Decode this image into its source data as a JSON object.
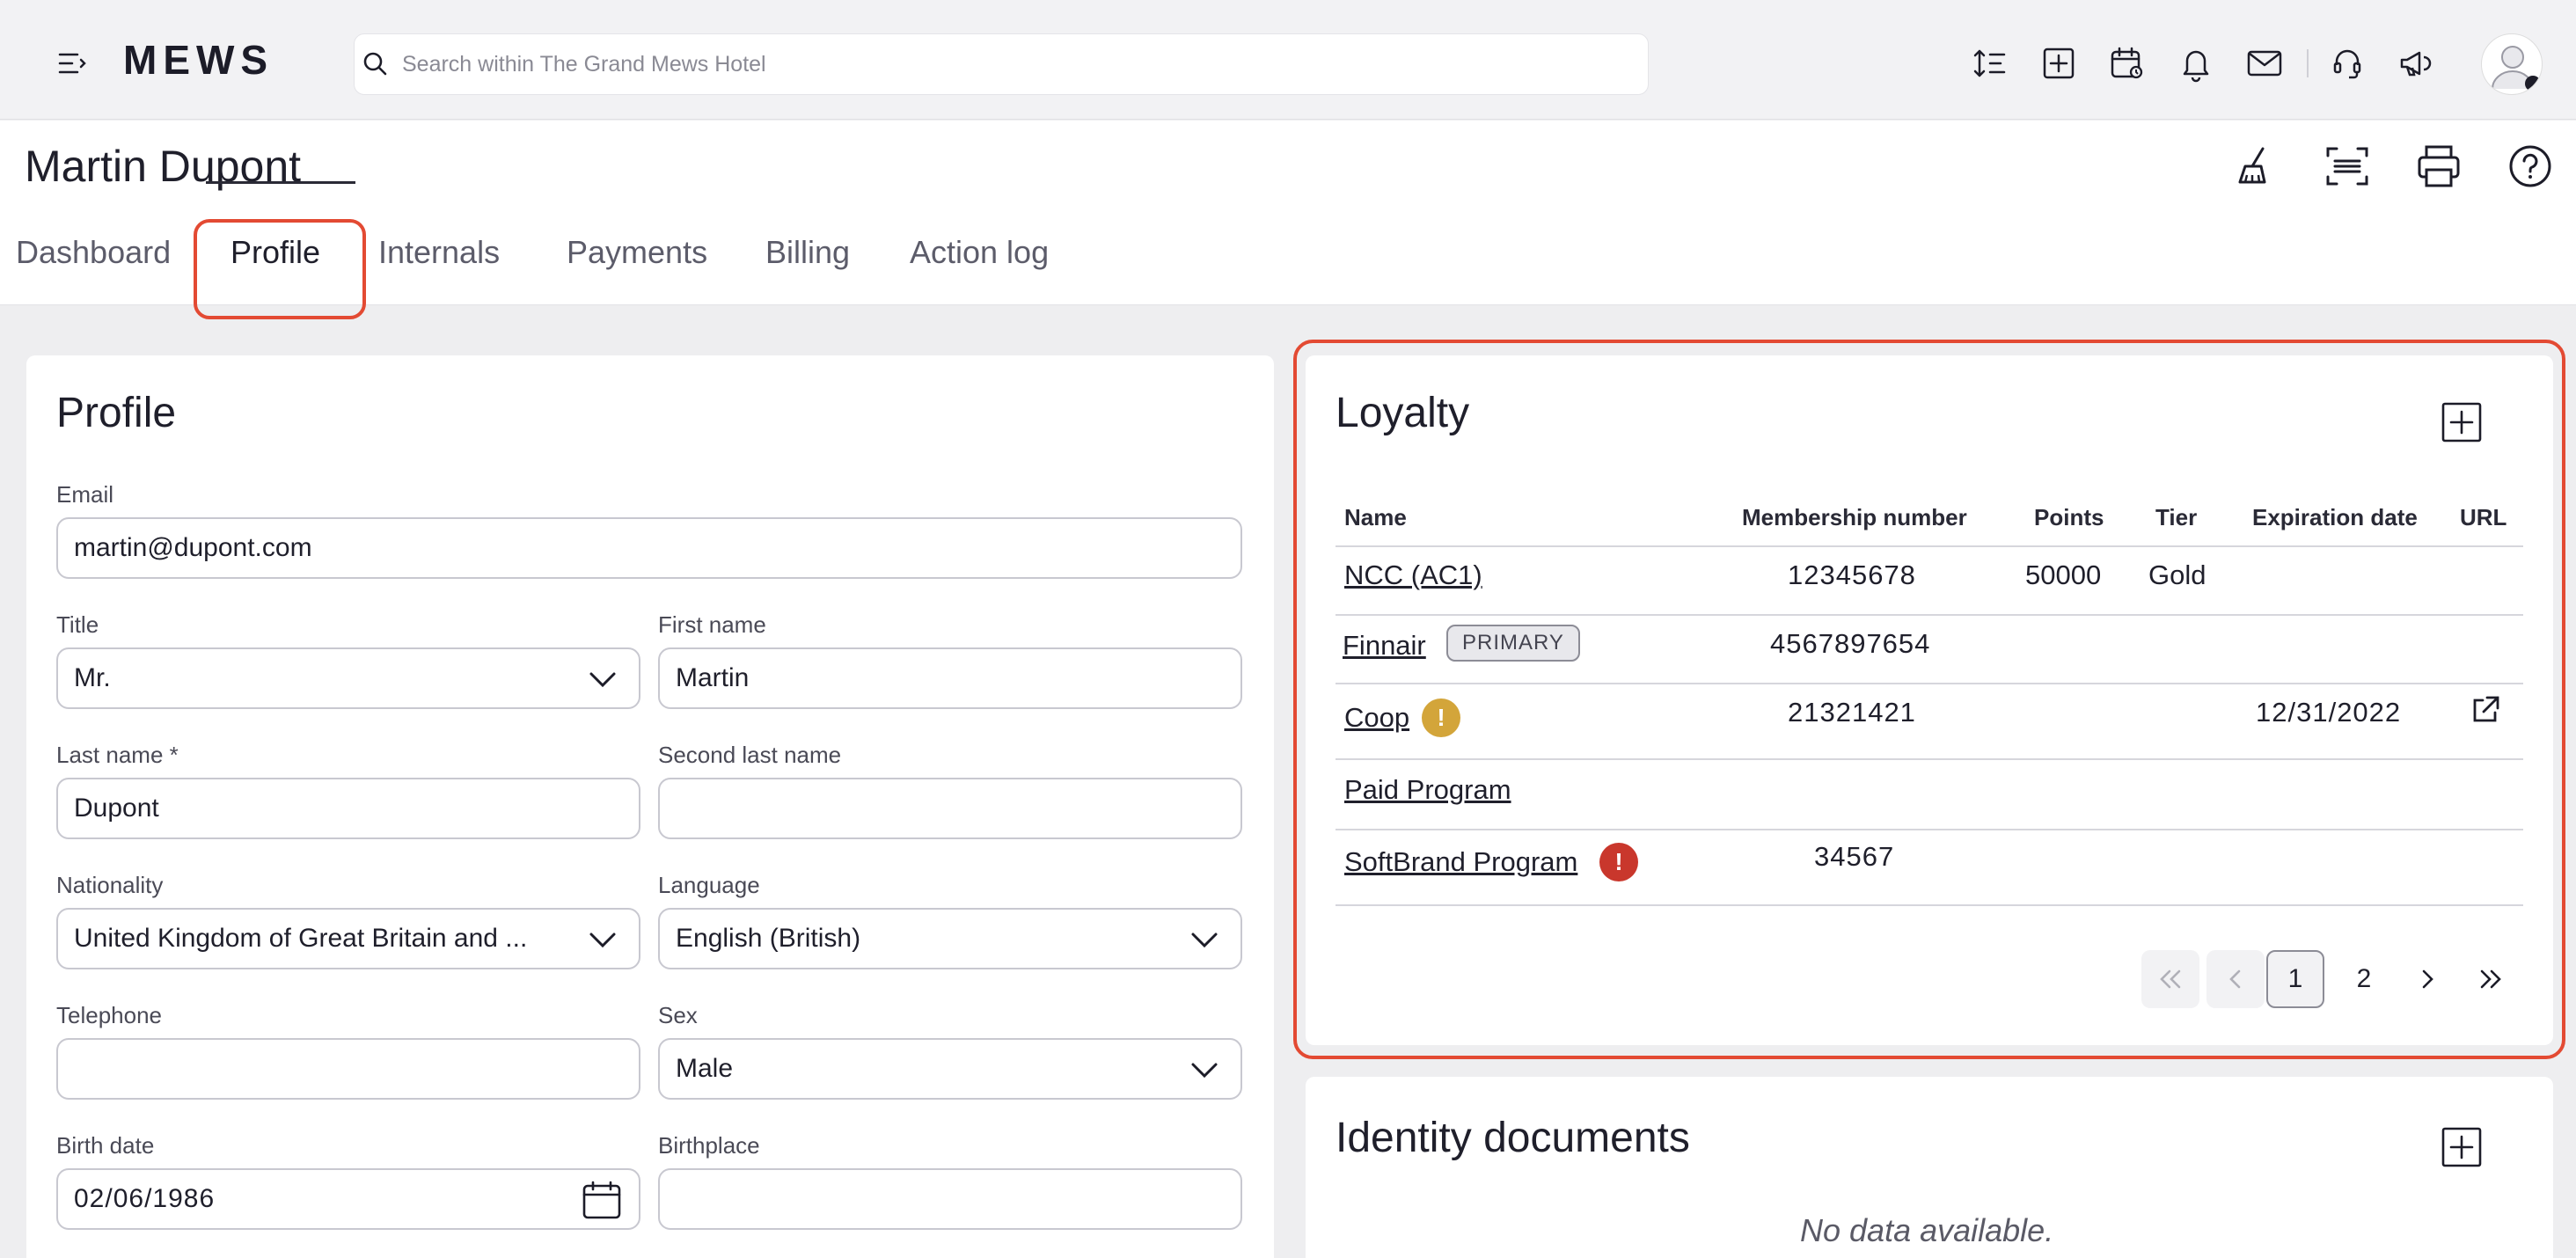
{
  "app": {
    "logo": "MEWS",
    "search_placeholder": "Search within The Grand Mews Hotel"
  },
  "topbar_icons": [
    "sort-icon",
    "add-icon",
    "calendar-icon",
    "bell-icon",
    "mail-icon",
    "support-icon",
    "announcement-icon"
  ],
  "header": {
    "title": "Martin Dupont",
    "icons": [
      "broom-icon",
      "scan-icon",
      "print-icon",
      "help-icon"
    ]
  },
  "tabs": [
    {
      "label": "Dashboard"
    },
    {
      "label": "Profile"
    },
    {
      "label": "Internals"
    },
    {
      "label": "Payments"
    },
    {
      "label": "Billing"
    },
    {
      "label": "Action log"
    }
  ],
  "active_tab": "Profile",
  "profile": {
    "title": "Profile",
    "email_label": "Email",
    "email_value": "martin@dupont.com",
    "title_label": "Title",
    "title_value": "Mr.",
    "first_name_label": "First name",
    "first_name_value": "Martin",
    "last_name_label": "Last name *",
    "last_name_value": "Dupont",
    "second_last_name_label": "Second last name",
    "second_last_name_value": "",
    "nationality_label": "Nationality",
    "nationality_value": "United Kingdom of Great Britain and ...",
    "language_label": "Language",
    "language_value": "English (British)",
    "telephone_label": "Telephone",
    "telephone_value": "",
    "sex_label": "Sex",
    "sex_value": "Male",
    "birth_date_label": "Birth date",
    "birth_date_value": "02/06/1986",
    "birthplace_label": "Birthplace",
    "birthplace_value": ""
  },
  "loyalty": {
    "title": "Loyalty",
    "columns": {
      "name": "Name",
      "membership": "Membership number",
      "points": "Points",
      "tier": "Tier",
      "expiration": "Expiration date",
      "url": "URL"
    },
    "rows": [
      {
        "name": "NCC (AC1)",
        "membership": "12345678",
        "points": "50000",
        "tier": "Gold",
        "expiration": ""
      },
      {
        "name": "Finnair",
        "badge": "PRIMARY",
        "membership": "4567897654",
        "points": "",
        "tier": "",
        "expiration": ""
      },
      {
        "name": "Coop",
        "warning": "!",
        "membership": "21321421",
        "points": "",
        "tier": "",
        "expiration": "12/31/2022"
      },
      {
        "name": "Paid Program",
        "membership": "",
        "points": "",
        "tier": "",
        "expiration": ""
      },
      {
        "name": "SoftBrand Program",
        "warning": "!",
        "membership": "34567",
        "points": "",
        "tier": "",
        "expiration": ""
      }
    ],
    "pagination": {
      "pages": [
        "1",
        "2"
      ],
      "current": "1"
    },
    "warning_colors": {
      "coop": "#d3a53a",
      "softbrand": "#c9372c"
    }
  },
  "identity": {
    "title": "Identity documents",
    "empty": "No data available."
  },
  "colors": {
    "highlight": "#e34a33",
    "accent_dark": "#1f1f2b"
  }
}
